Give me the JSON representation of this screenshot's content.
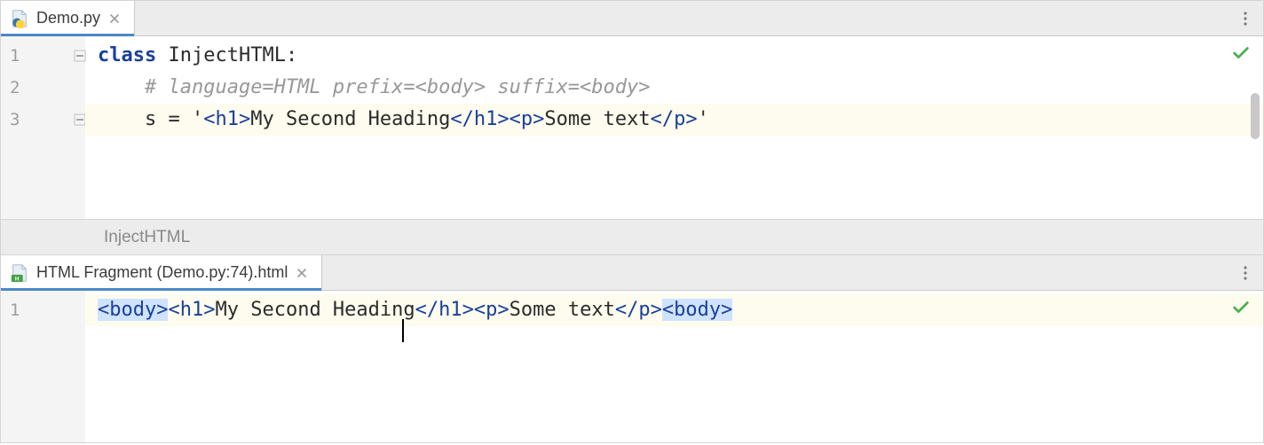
{
  "top": {
    "tab": {
      "label": "Demo.py"
    },
    "gutter": [
      "1",
      "2",
      "3"
    ],
    "code": {
      "l1": {
        "kw": "class",
        "space": " ",
        "name": "InjectHTML",
        "colon": ":"
      },
      "l2": {
        "comment": "# language=HTML prefix=<body> suffix=<body>"
      },
      "l3": {
        "var": "s",
        "eq": " = ",
        "q1": "'",
        "t1o": "<",
        "t1n": "h1",
        "t1c": ">",
        "txt1": "My Second Heading",
        "t2o": "</",
        "t2n": "h1",
        "t2c": ">",
        "t3o": "<",
        "t3n": "p",
        "t3c": ">",
        "txt2": "Some text",
        "t4o": "</",
        "t4n": "p",
        "t4c": ">",
        "q2": "'"
      }
    },
    "breadcrumb": "InjectHTML"
  },
  "bottom": {
    "tab": {
      "label": "HTML Fragment (Demo.py:74).html"
    },
    "gutter": [
      "1"
    ],
    "code": {
      "l1": {
        "b1o": "<",
        "b1n": "body",
        "b1c": ">",
        "t1o": "<",
        "t1n": "h1",
        "t1c": ">",
        "txt1a": "My Second Headin",
        "txt1b": "g",
        "t2o": "</",
        "t2n": "h1",
        "t2c": ">",
        "t3o": "<",
        "t3n": "p",
        "t3c": ">",
        "txt2": "Some text",
        "t4o": "</",
        "t4n": "p",
        "t4c": ">",
        "b2o": "<",
        "b2n": "body",
        "b2c": ">"
      }
    }
  }
}
